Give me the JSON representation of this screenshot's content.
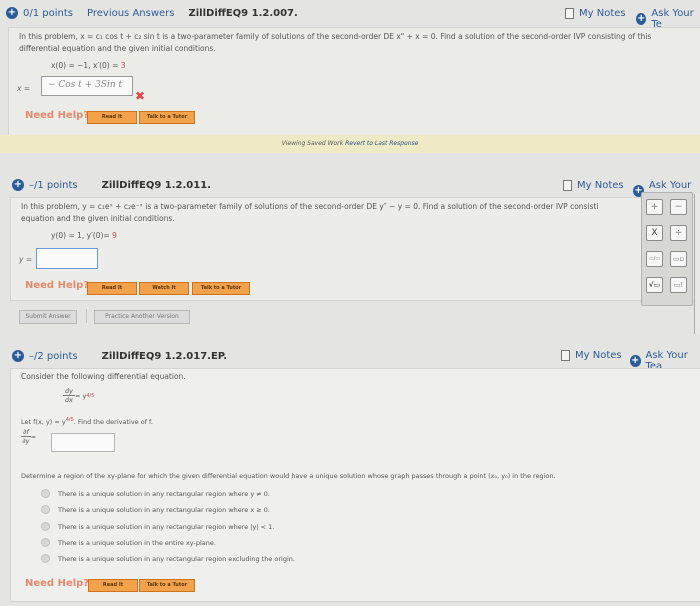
{
  "question1": {
    "points": "0/1 points",
    "previous_answers": "Previous Answers",
    "id": "ZillDiffEQ9 1.2.007.",
    "my_notes": "My Notes",
    "ask_teacher": "Ask Your Te",
    "text_line1": "In this problem, x = c₁ cos t + c₂ sin t is a two-parameter family of solutions of the second-order DE x\" + x = 0. Find a solution of the second-order IVP consisting of this",
    "text_line2": "differential equation and the given initial conditions.",
    "cond_a": "x(0) = −1,   x′(0) = ",
    "cond_b": "3",
    "answer_label": "x =",
    "answer_value": "− Cos t  +  3Sin t",
    "status": "incorrect",
    "need_help": "Need Help?",
    "help_buttons": [
      "Read It",
      "Talk to a Tutor"
    ],
    "saved_notice": "Viewing Saved Work",
    "revert_link": "Revert to Last Response"
  },
  "question2": {
    "points": "–/1 points",
    "id": "ZillDiffEQ9 1.2.011.",
    "my_notes": "My Notes",
    "ask_teacher": "Ask Your Te",
    "text_line1": "In this problem, y = c₁eˣ + c₂e⁻ˣ is a two-parameter family of solutions of the second-order DE y″ − y = 0. Find a solution of the second-order IVP consisti",
    "text_line2": "equation and the given initial conditions.",
    "cond_a": "y(0) = 1,   y′(0)= ",
    "cond_b": "9",
    "answer_label": "y =",
    "answer_value": "",
    "need_help": "Need Help?",
    "help_buttons": [
      "Read It",
      "Watch It",
      "Talk to a Tutor"
    ],
    "submit": "Submit Answer",
    "practice": "Practice Another Version",
    "math_toolbar": [
      "+",
      "−",
      "X",
      "÷",
      "▭/▭",
      "▭▫",
      "√▭",
      "▭!"
    ]
  },
  "question3": {
    "points": "–/2 points",
    "id": "ZillDiffEQ9 1.2.017.EP.",
    "my_notes": "My Notes",
    "ask_teacher": "Ask Your Tea",
    "intro": "Consider the following differential equation.",
    "eq_num": "dy",
    "eq_den": "dx",
    "eq_rhs": " = y",
    "eq_exp": "4/5",
    "let_text_a": "Let f(x, y) = y",
    "let_exp": "4/5",
    "let_text_b": ". Find the derivative of f.",
    "deriv_num": "∂f",
    "deriv_den": "∂y",
    "deriv_eq": " =",
    "answer_value": "",
    "determine": "Determine a region of the xy-plane for which the given differential equation would have a unique solution whose graph passes through a point (x₀, y₀) in the region.",
    "options": [
      "There is a unique solution in any rectangular region where y ≠ 0.",
      "There is a unique solution in any rectangular region where x ≥ 0.",
      "There is a unique solution in any rectangular region where |y| < 1.",
      "There is a unique solution in the entire xy-plane.",
      "There is a unique solution in any rectangular region excluding the origin."
    ],
    "need_help": "Need Help?",
    "help_buttons": [
      "Read It",
      "Talk to a Tutor"
    ]
  }
}
